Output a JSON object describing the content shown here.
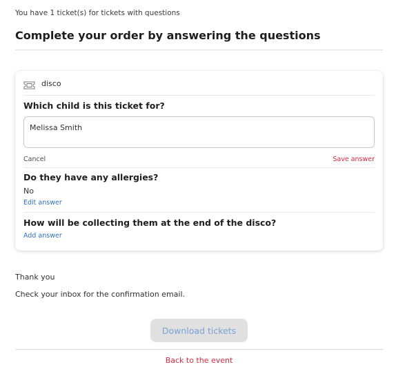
{
  "header": {
    "ticket_count_text": "You have 1 ticket(s) for tickets with questions",
    "title": "Complete your order by answering the questions"
  },
  "ticket_card": {
    "ticket_icon": "ticket-icon",
    "ticket_name": "disco",
    "questions": [
      {
        "question": "Which child is this ticket for?",
        "answer_value": "Melissa Smith",
        "cancel_label": "Cancel",
        "save_label": "Save answer"
      },
      {
        "question": "Do they have any allergies?",
        "answer": "No",
        "action_label": "Edit answer"
      },
      {
        "question": "How will be collecting them at the end of the disco?",
        "action_label": "Add answer"
      }
    ]
  },
  "footer": {
    "thank_you": "Thank you",
    "inbox_note": "Check your inbox for the confirmation email.",
    "download_label": "Download tickets",
    "back_label": "Back to the event"
  },
  "colors": {
    "accent_red": "#d62a3d",
    "link_blue": "#2f6fc1",
    "disabled_button_bg": "#e0e0e0",
    "disabled_button_text": "#7a9fd6"
  }
}
